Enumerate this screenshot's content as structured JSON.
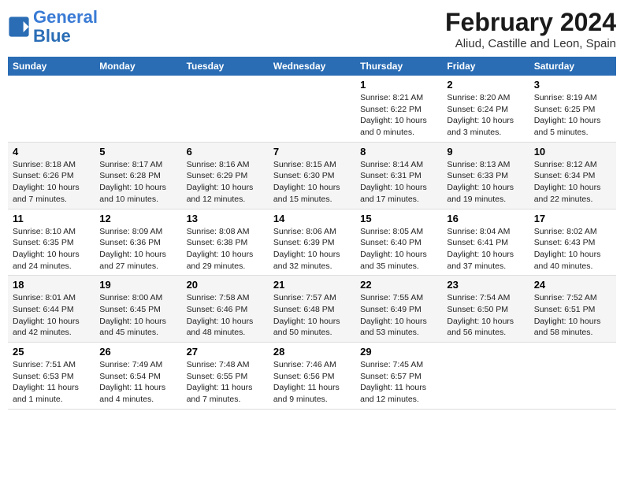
{
  "header": {
    "logo_line1": "General",
    "logo_line2": "Blue",
    "title": "February 2024",
    "subtitle": "Aliud, Castille and Leon, Spain"
  },
  "days_of_week": [
    "Sunday",
    "Monday",
    "Tuesday",
    "Wednesday",
    "Thursday",
    "Friday",
    "Saturday"
  ],
  "weeks": [
    [
      {
        "num": "",
        "info": ""
      },
      {
        "num": "",
        "info": ""
      },
      {
        "num": "",
        "info": ""
      },
      {
        "num": "",
        "info": ""
      },
      {
        "num": "1",
        "info": "Sunrise: 8:21 AM\nSunset: 6:22 PM\nDaylight: 10 hours and 0 minutes."
      },
      {
        "num": "2",
        "info": "Sunrise: 8:20 AM\nSunset: 6:24 PM\nDaylight: 10 hours and 3 minutes."
      },
      {
        "num": "3",
        "info": "Sunrise: 8:19 AM\nSunset: 6:25 PM\nDaylight: 10 hours and 5 minutes."
      }
    ],
    [
      {
        "num": "4",
        "info": "Sunrise: 8:18 AM\nSunset: 6:26 PM\nDaylight: 10 hours and 7 minutes."
      },
      {
        "num": "5",
        "info": "Sunrise: 8:17 AM\nSunset: 6:28 PM\nDaylight: 10 hours and 10 minutes."
      },
      {
        "num": "6",
        "info": "Sunrise: 8:16 AM\nSunset: 6:29 PM\nDaylight: 10 hours and 12 minutes."
      },
      {
        "num": "7",
        "info": "Sunrise: 8:15 AM\nSunset: 6:30 PM\nDaylight: 10 hours and 15 minutes."
      },
      {
        "num": "8",
        "info": "Sunrise: 8:14 AM\nSunset: 6:31 PM\nDaylight: 10 hours and 17 minutes."
      },
      {
        "num": "9",
        "info": "Sunrise: 8:13 AM\nSunset: 6:33 PM\nDaylight: 10 hours and 19 minutes."
      },
      {
        "num": "10",
        "info": "Sunrise: 8:12 AM\nSunset: 6:34 PM\nDaylight: 10 hours and 22 minutes."
      }
    ],
    [
      {
        "num": "11",
        "info": "Sunrise: 8:10 AM\nSunset: 6:35 PM\nDaylight: 10 hours and 24 minutes."
      },
      {
        "num": "12",
        "info": "Sunrise: 8:09 AM\nSunset: 6:36 PM\nDaylight: 10 hours and 27 minutes."
      },
      {
        "num": "13",
        "info": "Sunrise: 8:08 AM\nSunset: 6:38 PM\nDaylight: 10 hours and 29 minutes."
      },
      {
        "num": "14",
        "info": "Sunrise: 8:06 AM\nSunset: 6:39 PM\nDaylight: 10 hours and 32 minutes."
      },
      {
        "num": "15",
        "info": "Sunrise: 8:05 AM\nSunset: 6:40 PM\nDaylight: 10 hours and 35 minutes."
      },
      {
        "num": "16",
        "info": "Sunrise: 8:04 AM\nSunset: 6:41 PM\nDaylight: 10 hours and 37 minutes."
      },
      {
        "num": "17",
        "info": "Sunrise: 8:02 AM\nSunset: 6:43 PM\nDaylight: 10 hours and 40 minutes."
      }
    ],
    [
      {
        "num": "18",
        "info": "Sunrise: 8:01 AM\nSunset: 6:44 PM\nDaylight: 10 hours and 42 minutes."
      },
      {
        "num": "19",
        "info": "Sunrise: 8:00 AM\nSunset: 6:45 PM\nDaylight: 10 hours and 45 minutes."
      },
      {
        "num": "20",
        "info": "Sunrise: 7:58 AM\nSunset: 6:46 PM\nDaylight: 10 hours and 48 minutes."
      },
      {
        "num": "21",
        "info": "Sunrise: 7:57 AM\nSunset: 6:48 PM\nDaylight: 10 hours and 50 minutes."
      },
      {
        "num": "22",
        "info": "Sunrise: 7:55 AM\nSunset: 6:49 PM\nDaylight: 10 hours and 53 minutes."
      },
      {
        "num": "23",
        "info": "Sunrise: 7:54 AM\nSunset: 6:50 PM\nDaylight: 10 hours and 56 minutes."
      },
      {
        "num": "24",
        "info": "Sunrise: 7:52 AM\nSunset: 6:51 PM\nDaylight: 10 hours and 58 minutes."
      }
    ],
    [
      {
        "num": "25",
        "info": "Sunrise: 7:51 AM\nSunset: 6:53 PM\nDaylight: 11 hours and 1 minute."
      },
      {
        "num": "26",
        "info": "Sunrise: 7:49 AM\nSunset: 6:54 PM\nDaylight: 11 hours and 4 minutes."
      },
      {
        "num": "27",
        "info": "Sunrise: 7:48 AM\nSunset: 6:55 PM\nDaylight: 11 hours and 7 minutes."
      },
      {
        "num": "28",
        "info": "Sunrise: 7:46 AM\nSunset: 6:56 PM\nDaylight: 11 hours and 9 minutes."
      },
      {
        "num": "29",
        "info": "Sunrise: 7:45 AM\nSunset: 6:57 PM\nDaylight: 11 hours and 12 minutes."
      },
      {
        "num": "",
        "info": ""
      },
      {
        "num": "",
        "info": ""
      }
    ]
  ]
}
